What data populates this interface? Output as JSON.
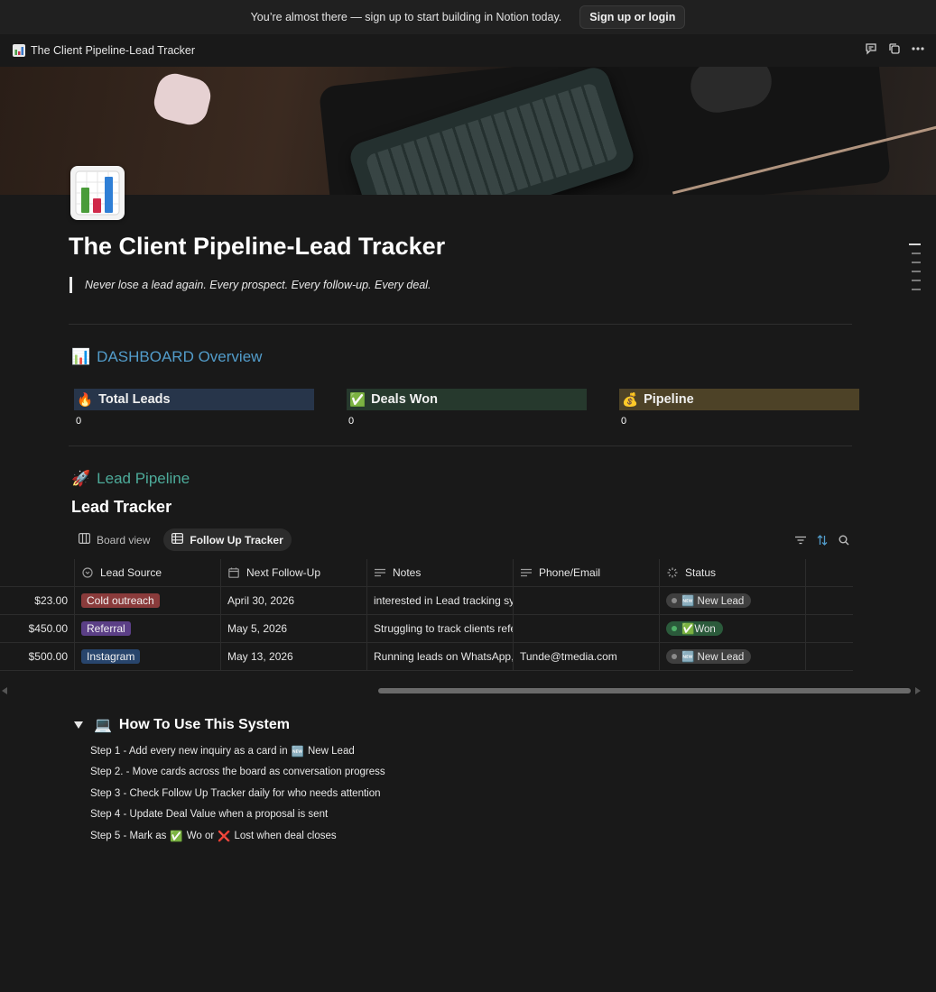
{
  "banner": {
    "text": "You’re almost there — sign up to start building in Notion today.",
    "button": "Sign up or login"
  },
  "topbar": {
    "page_icon": "bar-chart-icon",
    "title": "The Client Pipeline-Lead Tracker",
    "actions": [
      "comment-icon",
      "duplicate-icon",
      "more-icon"
    ]
  },
  "page": {
    "title": "The Client Pipeline-Lead Tracker",
    "quote": "Never lose a lead again. Every prospect. Every follow-up. Every deal."
  },
  "dashboard": {
    "heading": "DASHBOARD Overview",
    "heading_emoji": "📊",
    "color": "#529cca",
    "stats": [
      {
        "emoji": "🔥",
        "label": "Total Leads",
        "value": "0",
        "color": "#27354a"
      },
      {
        "emoji": "✅",
        "label": "Deals Won",
        "value": "0",
        "color": "#26392d"
      },
      {
        "emoji": "💰",
        "label": "Pipeline",
        "value": "0",
        "color": "#4d4227"
      }
    ]
  },
  "pipeline": {
    "heading": "Lead Pipeline",
    "heading_emoji": "🚀",
    "color": "#4dab9a"
  },
  "database": {
    "title": "Lead Tracker",
    "views": [
      {
        "label": "Board view",
        "icon": "board-icon",
        "active": false
      },
      {
        "label": "Follow Up Tracker",
        "icon": "table-icon",
        "active": true
      }
    ],
    "tools": [
      "filter-icon",
      "sort-icon",
      "search-icon"
    ],
    "columns": [
      {
        "label": "",
        "icon": ""
      },
      {
        "label": "Lead Source",
        "icon": "select-icon"
      },
      {
        "label": "Next Follow-Up",
        "icon": "calendar-icon"
      },
      {
        "label": "Notes",
        "icon": "text-icon"
      },
      {
        "label": "Phone/Email",
        "icon": "text-icon"
      },
      {
        "label": "Status",
        "icon": "status-icon"
      }
    ],
    "rows": [
      {
        "value": "$23.00",
        "source": "Cold outreach",
        "source_color": "#8a3b3b",
        "date": "April 30, 2026",
        "notes": "interested in Lead tracking syste",
        "contact": "",
        "status": "🆕 New Lead",
        "status_bg": "#3f3f3f",
        "status_dot": "#8a8a8a"
      },
      {
        "value": "$450.00",
        "source": "Referral",
        "source_color": "#5b3f86",
        "date": "May 5, 2026",
        "notes": "Struggling to track clients referr",
        "contact": "",
        "status": "✅Won",
        "status_bg": "#2b5a3b",
        "status_dot": "#4fb068"
      },
      {
        "value": "$500.00",
        "source": "Instagram",
        "source_color": "#28456c",
        "date": "May 13, 2026",
        "notes": "Running leads on WhatsApp, ne",
        "contact": "Tunde@tmedia.com",
        "status": "🆕 New Lead",
        "status_bg": "#3f3f3f",
        "status_dot": "#8a8a8a"
      }
    ]
  },
  "how_to": {
    "title": "How To Use This System",
    "emoji": "💻",
    "steps": [
      {
        "pre": "Step 1 - Add every new inquiry as a card in ",
        "emoji": "🆕",
        "post": " New Lead"
      },
      {
        "pre": "Step 2. - Move cards across the board as conversation progress",
        "emoji": "",
        "post": ""
      },
      {
        "pre": "Step 3 - Check Follow Up Tracker daily for who needs attention",
        "emoji": "",
        "post": ""
      },
      {
        "pre": "Step 4 - Update Deal Value when a proposal is sent",
        "emoji": "",
        "post": ""
      },
      {
        "pre": "Step 5 - Mark as ",
        "emoji": "✅",
        "post": " Wo or ",
        "emoji2": "❌",
        "post2": " Lost when deal closes"
      }
    ]
  }
}
